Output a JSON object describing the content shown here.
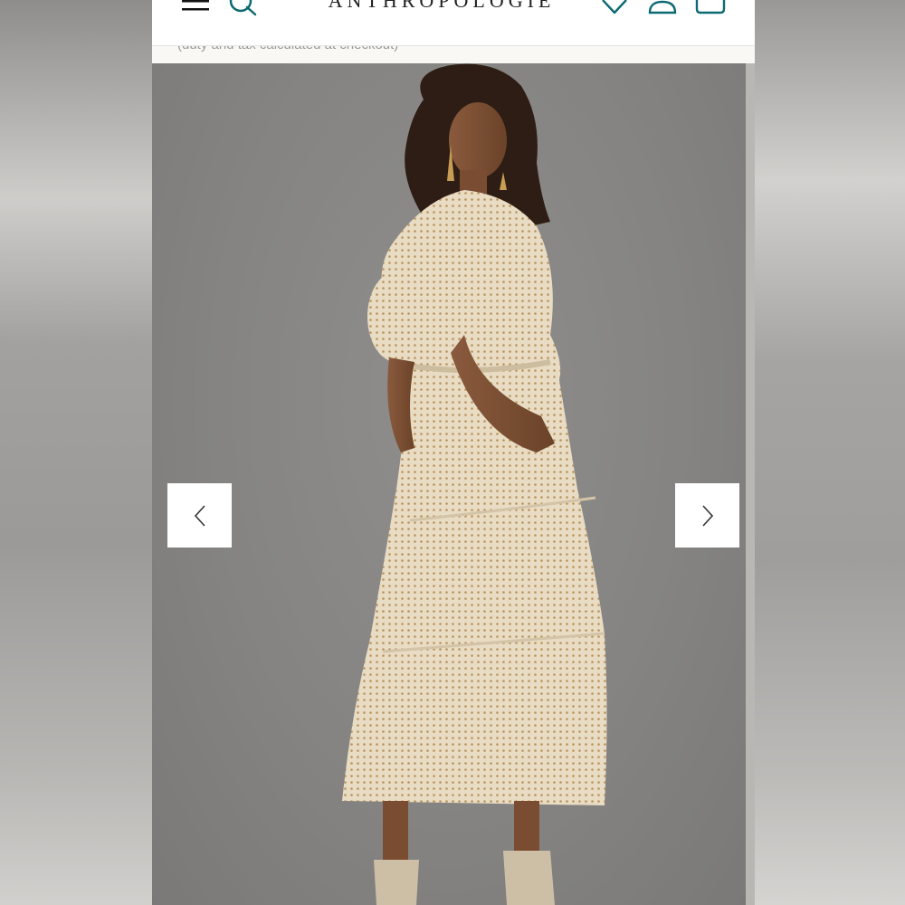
{
  "header": {
    "logo_text": "ANTHROPOLOGIE",
    "menu_icon": "hamburger-menu-icon",
    "search_icon": "search-icon",
    "wishlist_icon": "heart-icon",
    "account_icon": "user-icon",
    "bag_icon": "shopping-bag-icon",
    "accent_color": "#0d6a72"
  },
  "subbar": {
    "note": "(duty and tax calculated at checkout)"
  },
  "carousel": {
    "prev_icon": "chevron-left-icon",
    "next_icon": "chevron-right-icon",
    "image_subject": "model wearing tiered cream printed midi dress, back view"
  }
}
